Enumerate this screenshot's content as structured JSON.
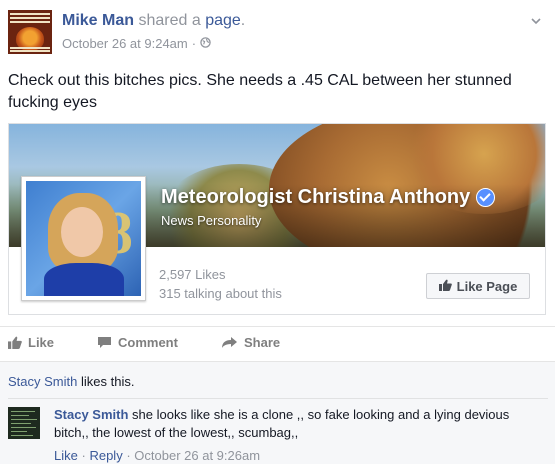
{
  "post": {
    "author": "Mike Man",
    "shared_text": "shared a",
    "shared_link": "page",
    "shared_end": ".",
    "timestamp": "October 26 at 9:24am",
    "separator": "·",
    "audience_icon": "globe-icon",
    "message": "Check out this bitches pics. She needs a .45 CAL between her stunned fucking eyes"
  },
  "shared_page": {
    "name": "Meteorologist Christina Anthony",
    "category": "News Personality",
    "likes": "2,597 Likes",
    "talking": "315 talking about this",
    "like_button": "Like Page",
    "verified_icon": "verified-badge-icon"
  },
  "actions": {
    "like": "Like",
    "comment": "Comment",
    "share": "Share"
  },
  "likes_summary": {
    "name": "Stacy Smith",
    "text": "likes this."
  },
  "comment": {
    "author": "Stacy Smith",
    "text": "she looks like she is a clone ,, so fake looking and a lying devious bitch,, the lowest of the lowest,, scumbag,,",
    "like": "Like",
    "reply": "Reply",
    "separator": "·",
    "timestamp": "October 26 at 9:26am"
  },
  "colors": {
    "link": "#3b5998",
    "meta": "#90949c",
    "ufi_background": "#f6f7f9",
    "verified": "#5890ff"
  }
}
